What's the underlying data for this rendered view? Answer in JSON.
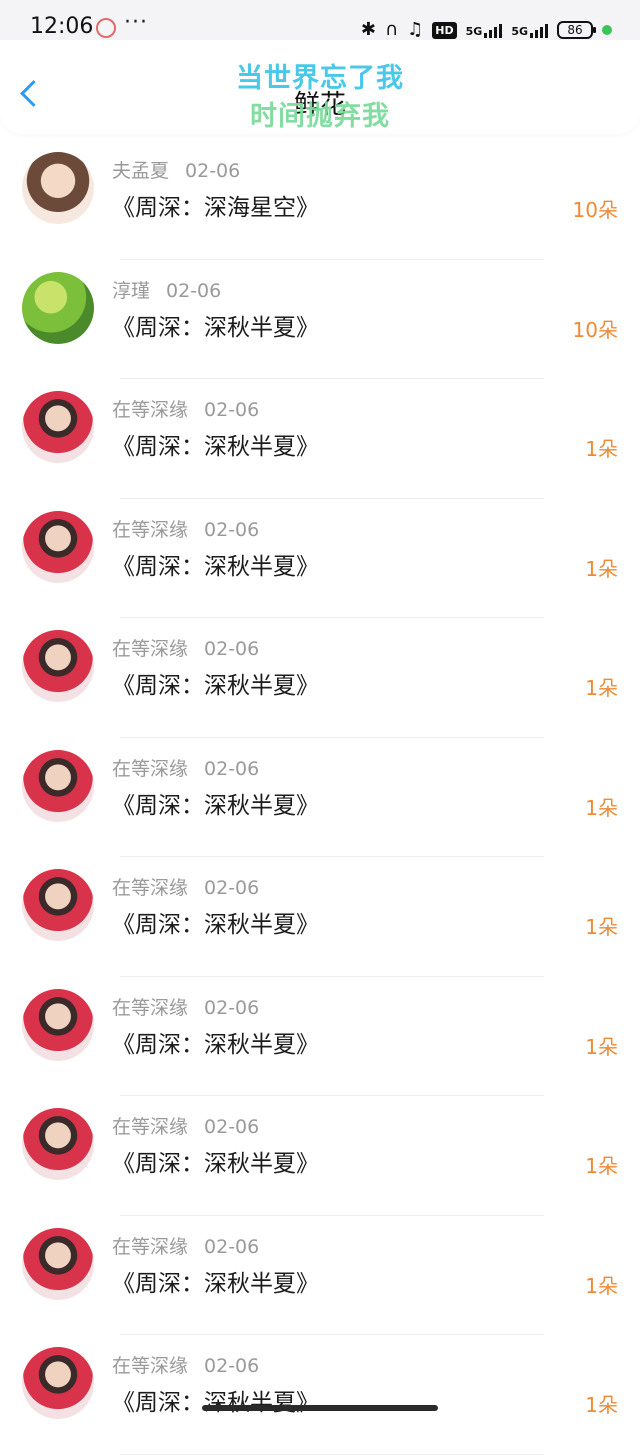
{
  "status_bar": {
    "time": "12:06",
    "dots": "···",
    "hd": "HD",
    "net1": "5G",
    "net2": "5G",
    "battery": "86"
  },
  "header": {
    "title": "鲜花",
    "overlay_line1": "当世界忘了我",
    "overlay_line2": "时间抛弃我"
  },
  "rows": [
    {
      "user": "夫孟夏",
      "date": "02-06",
      "text": "《周深：深海星空》",
      "count": "10朵",
      "avatar": "girl"
    },
    {
      "user": "淳瑾",
      "date": "02-06",
      "text": "《周深：深秋半夏》",
      "count": "10朵",
      "avatar": "green"
    },
    {
      "user": "在等深缘",
      "date": "02-06",
      "text": "《周深：深秋半夏》",
      "count": "1朵",
      "avatar": "boy"
    },
    {
      "user": "在等深缘",
      "date": "02-06",
      "text": "《周深：深秋半夏》",
      "count": "1朵",
      "avatar": "boy"
    },
    {
      "user": "在等深缘",
      "date": "02-06",
      "text": "《周深：深秋半夏》",
      "count": "1朵",
      "avatar": "boy"
    },
    {
      "user": "在等深缘",
      "date": "02-06",
      "text": "《周深：深秋半夏》",
      "count": "1朵",
      "avatar": "boy"
    },
    {
      "user": "在等深缘",
      "date": "02-06",
      "text": "《周深：深秋半夏》",
      "count": "1朵",
      "avatar": "boy"
    },
    {
      "user": "在等深缘",
      "date": "02-06",
      "text": "《周深：深秋半夏》",
      "count": "1朵",
      "avatar": "boy"
    },
    {
      "user": "在等深缘",
      "date": "02-06",
      "text": "《周深：深秋半夏》",
      "count": "1朵",
      "avatar": "boy"
    },
    {
      "user": "在等深缘",
      "date": "02-06",
      "text": "《周深：深秋半夏》",
      "count": "1朵",
      "avatar": "boy"
    },
    {
      "user": "在等深缘",
      "date": "02-06",
      "text": "《周深：深秋半夏》",
      "count": "1朵",
      "avatar": "boy"
    }
  ]
}
